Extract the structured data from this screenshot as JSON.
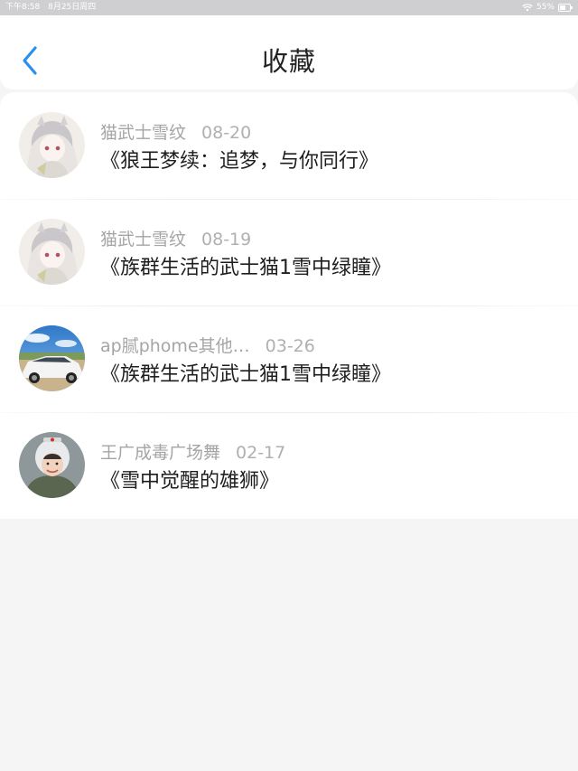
{
  "status_bar": {
    "time": "下午8:58",
    "date": "8月25日周四",
    "battery": "55%",
    "icons": [
      "wifi-icon",
      "battery-icon"
    ]
  },
  "header": {
    "title": "收藏",
    "back_icon": "chevron-left-icon"
  },
  "colors": {
    "accent": "#2b8ff0",
    "title_text": "#222222",
    "meta_text": "#a5a5a7",
    "background": "#f6f5f6"
  },
  "favorites": [
    {
      "author": "猫武士雪纹",
      "date": "08-20",
      "title": "《狼王梦续：追梦，与你同行》",
      "avatar": "anime-girl-avatar"
    },
    {
      "author": "猫武士雪纹",
      "date": "08-19",
      "title": "《族群生活的武士猫1雪中绿瞳》",
      "avatar": "anime-girl-avatar"
    },
    {
      "author": "ap腻phome其他…",
      "date": "03-26",
      "title": "《族群生活的武士猫1雪中绿瞳》",
      "avatar": "white-car-avatar"
    },
    {
      "author": "王广成毒广场舞",
      "date": "02-17",
      "title": "《雪中觉醒的雄狮》",
      "avatar": "pilot-girl-avatar"
    }
  ]
}
